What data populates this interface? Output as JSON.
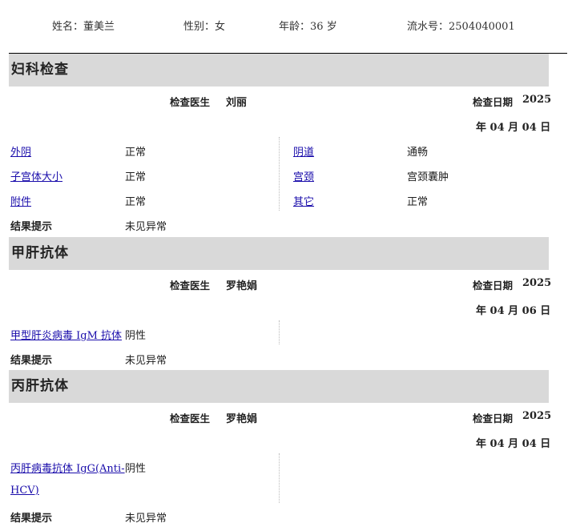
{
  "patient": {
    "name_label": "姓名：",
    "name": "董美兰",
    "gender_label": "性别：",
    "gender": "女",
    "age_label": "年龄：",
    "age": "36 岁",
    "serial_label": "流水号：",
    "serial": "2504040001"
  },
  "sections": [
    {
      "title": "妇科检查",
      "doctor_label": "检查医生",
      "doctor": "刘丽",
      "date_label": "检查日期",
      "date_line1": "2025",
      "date_line2": "年 04 月 04 日",
      "left_items": [
        {
          "name": "外阴",
          "value": "正常"
        },
        {
          "name": "子宫体大小",
          "value": "正常"
        },
        {
          "name": "附件",
          "value": "正常"
        }
      ],
      "right_items": [
        {
          "name": "阴道",
          "value": "通畅"
        },
        {
          "name": "宫颈",
          "value": "宫颈囊肿"
        },
        {
          "name": "其它",
          "value": "正常"
        }
      ],
      "result_label": "结果提示",
      "result": "未见异常"
    },
    {
      "title": "甲肝抗体",
      "doctor_label": "检查医生",
      "doctor": "罗艳娟",
      "date_label": "检查日期",
      "date_line1": "2025",
      "date_line2": "年 04 月 06 日",
      "left_items": [
        {
          "name": "甲型肝炎病毒 IgM 抗体",
          "value": "阴性"
        }
      ],
      "result_label": "结果提示",
      "result": "未见异常"
    },
    {
      "title": "丙肝抗体",
      "doctor_label": "检查医生",
      "doctor": "罗艳娟",
      "date_label": "检查日期",
      "date_line1": "2025",
      "date_line2": "年 04 月 04 日",
      "left_items": [
        {
          "name_line1": "丙肝病毒抗体 IgG(Anti-",
          "name_line2": "HCV)",
          "value": "阴性"
        }
      ],
      "result_label": "结果提示",
      "result": "未见异常"
    }
  ],
  "colors": {
    "link": "#1a0dab",
    "section_bg": "#d9d9d9"
  }
}
